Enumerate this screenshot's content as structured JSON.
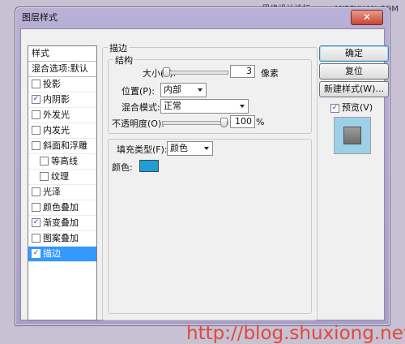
{
  "watermark_top": "思缘设计论坛 www.MISSYUAN.COM",
  "window": {
    "title": "图层样式",
    "close_glyph": "✕"
  },
  "style_list": {
    "header": "样式",
    "blend_default": "混合选项:默认",
    "items": [
      {
        "label": "投影",
        "checked": false,
        "indent": false,
        "selected": false
      },
      {
        "label": "内阴影",
        "checked": true,
        "indent": false,
        "selected": false
      },
      {
        "label": "外发光",
        "checked": false,
        "indent": false,
        "selected": false
      },
      {
        "label": "内发光",
        "checked": false,
        "indent": false,
        "selected": false
      },
      {
        "label": "斜面和浮雕",
        "checked": false,
        "indent": false,
        "selected": false
      },
      {
        "label": "等高线",
        "checked": false,
        "indent": true,
        "selected": false
      },
      {
        "label": "纹理",
        "checked": false,
        "indent": true,
        "selected": false
      },
      {
        "label": "光泽",
        "checked": false,
        "indent": false,
        "selected": false
      },
      {
        "label": "颜色叠加",
        "checked": false,
        "indent": false,
        "selected": false
      },
      {
        "label": "渐变叠加",
        "checked": true,
        "indent": false,
        "selected": false
      },
      {
        "label": "图案叠加",
        "checked": false,
        "indent": false,
        "selected": false
      },
      {
        "label": "描边",
        "checked": true,
        "indent": false,
        "selected": true
      }
    ]
  },
  "stroke": {
    "section_title": "描边",
    "structure_title": "结构",
    "size_label": "大小(S):",
    "size_value": "3",
    "size_unit": "像素",
    "size_fraction": 0.02,
    "position_label": "位置(P):",
    "position_value": "内部",
    "blend_label": "混合模式:",
    "blend_value": "正常",
    "opacity_label": "不透明度(O):",
    "opacity_value": "100",
    "opacity_unit": "%",
    "opacity_fraction": 1.0,
    "fill_type_label": "填充类型(F):",
    "fill_type_value": "颜色",
    "color_label": "颜色:",
    "color_hex": "#1f9ed8"
  },
  "buttons": {
    "ok": "确定",
    "reset": "复位",
    "new_style": "新建样式(W)...",
    "preview_label": "预览(V)",
    "preview_checked": true
  },
  "watermark_bottom": "http://blog.shuxiong.net"
}
